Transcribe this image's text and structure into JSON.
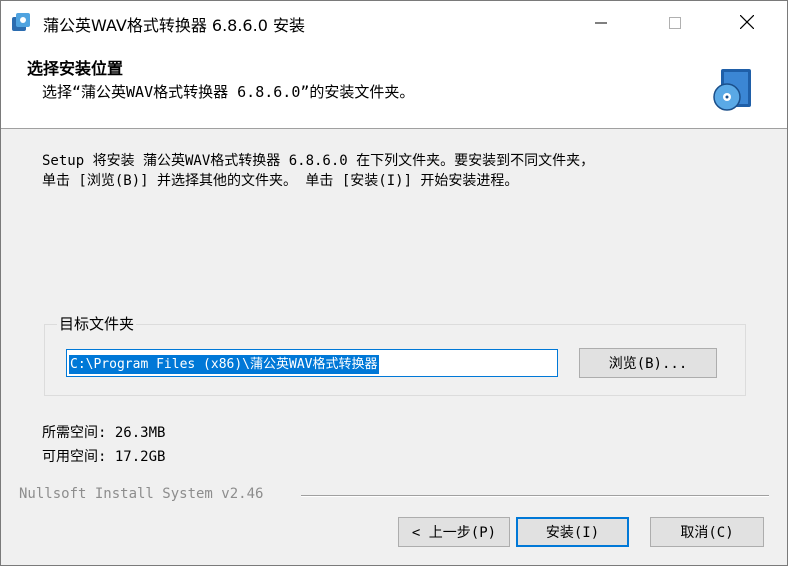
{
  "window": {
    "title": "蒲公英WAV格式转换器 6.8.6.0 安装",
    "app_icon": "installer-app-icon",
    "controls": {
      "minimize_icon": "minimize-icon",
      "maximize_icon": "maximize-icon",
      "close_icon": "close-icon"
    }
  },
  "header": {
    "title": "选择安装位置",
    "subtitle": "选择“蒲公英WAV格式转换器 6.8.6.0”的安装文件夹。",
    "icon": "install-disc-icon"
  },
  "body": {
    "description_line1": "Setup 将安装 蒲公英WAV格式转换器 6.8.6.0 在下列文件夹。要安装到不同文件夹，",
    "description_line2": "单击 [浏览(B)] 并选择其他的文件夹。 单击 [安装(I)] 开始安装进程。",
    "destination_group_label": "目标文件夹",
    "destination_path": "C:\\Program Files (x86)\\蒲公英WAV格式转换器",
    "browse_label": "浏览(B)...",
    "space_required": "所需空间: 26.3MB",
    "space_available": "可用空间: 17.2GB"
  },
  "footer": {
    "branding": "Nullsoft Install System v2.46",
    "back_label": "< 上一步(P)",
    "install_label": "安装(I)",
    "cancel_label": "取消(C)"
  },
  "colors": {
    "accent": "#0078d7",
    "window_bg": "#f0f0f0",
    "header_bg": "#ffffff",
    "button_bg": "#e1e1e1"
  }
}
